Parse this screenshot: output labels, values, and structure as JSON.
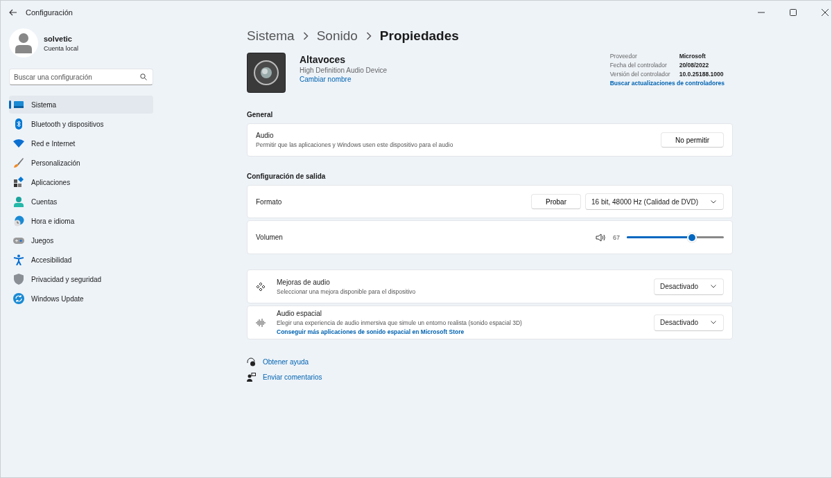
{
  "window": {
    "title": "Configuración"
  },
  "user": {
    "name": "solvetic",
    "account": "Cuenta local"
  },
  "search": {
    "placeholder": "Buscar una configuración"
  },
  "sidebar": {
    "items": [
      {
        "label": "Sistema",
        "selected": true
      },
      {
        "label": "Bluetooth y dispositivos",
        "selected": false
      },
      {
        "label": "Red e Internet",
        "selected": false
      },
      {
        "label": "Personalización",
        "selected": false
      },
      {
        "label": "Aplicaciones",
        "selected": false
      },
      {
        "label": "Cuentas",
        "selected": false
      },
      {
        "label": "Hora e idioma",
        "selected": false
      },
      {
        "label": "Juegos",
        "selected": false
      },
      {
        "label": "Accesibilidad",
        "selected": false
      },
      {
        "label": "Privacidad y seguridad",
        "selected": false
      },
      {
        "label": "Windows Update",
        "selected": false
      }
    ]
  },
  "breadcrumb": [
    "Sistema",
    "Sonido",
    "Propiedades"
  ],
  "device": {
    "name": "Altavoces",
    "description": "High Definition Audio Device",
    "rename_link": "Cambiar nombre"
  },
  "driver_info": [
    {
      "label": "Proveedor",
      "value": "Microsoft"
    },
    {
      "label": "Fecha del controlador",
      "value": "20/08/2022"
    },
    {
      "label": "Versión del controlador",
      "value": "10.0.25188.1000"
    }
  ],
  "driver_update_link": "Buscar actualizaciones de controladores",
  "general": {
    "heading": "General",
    "title": "Audio",
    "description": "Permitir que las aplicaciones y Windows usen este dispositivo para el audio",
    "button": "No permitir"
  },
  "output": {
    "heading": "Configuración de salida",
    "format_label": "Formato",
    "test_button": "Probar",
    "format_value": "16 bit, 48000 Hz (Calidad de DVD)",
    "volume_label": "Volumen",
    "volume_reading": "67",
    "level": 0.67
  },
  "enhancements": [
    {
      "title": "Mejoras de audio",
      "description": "Seleccionar una mejora disponible para el dispositivo",
      "value": "Desactivado"
    },
    {
      "title": "Audio espacial",
      "description": "Elegir una experiencia de audio inmersiva que simule un entorno realista (sonido espacial 3D)",
      "link": "Conseguir más aplicaciones de sonido espacial en Microsoft Store",
      "value": "Desactivado"
    }
  ],
  "help_links": [
    "Obtener ayuda",
    "Enviar comentarios"
  ]
}
